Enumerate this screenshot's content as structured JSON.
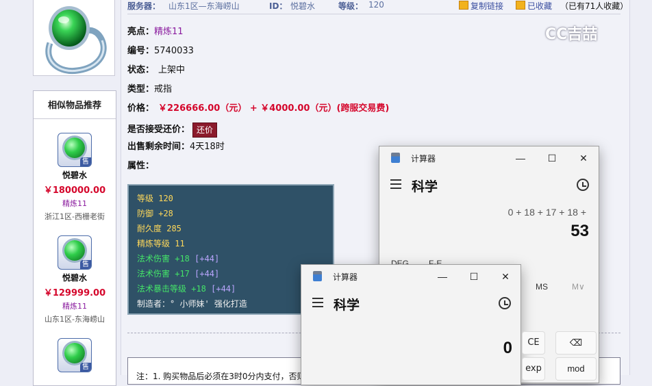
{
  "header": {
    "server_label": "服务器：",
    "server_value": "山东1区—东海崂山",
    "id_label": "ID：",
    "id_value": "悦碧水",
    "level_label": "等级：",
    "level_value": "120",
    "copy_link": "复制链接",
    "favorited": "已收藏",
    "fav_count_text": "（已有71人收藏）"
  },
  "watermark": "CC吉喆",
  "sidebar": {
    "similar_title": "相似物品推荐",
    "items": [
      {
        "name": "悦碧水",
        "price": "￥180000.00",
        "refine": "精炼11",
        "server": "浙江1区-西栅老街",
        "badge": "售"
      },
      {
        "name": "悦碧水",
        "price": "￥129999.00",
        "refine": "精炼11",
        "server": "山东1区-东海崂山",
        "badge": "售"
      },
      {
        "name": "",
        "price": "",
        "refine": "",
        "server": "",
        "badge": "售"
      }
    ]
  },
  "details": {
    "highlight_label": "亮点：",
    "highlight_value": "精炼11",
    "number_label": "编号：",
    "number_value": "5740033",
    "status_label": "状态：",
    "status_value": "上架中",
    "type_label": "类型：",
    "type_value": "戒指",
    "price_label": "价格：",
    "price_value": "￥226666.00（元） + ￥4000.00（元）(跨服交易费)",
    "counter_label": "是否接受还价：",
    "counter_button": "还价",
    "remain_label": "出售剩余时间：",
    "remain_value": "4天18时",
    "attr_label": "属性："
  },
  "attributes": [
    {
      "text": "等级 120",
      "style": "yellow",
      "bonus": ""
    },
    {
      "text": "防御 +28",
      "style": "yellow",
      "bonus": ""
    },
    {
      "text": "耐久度 285",
      "style": "yellow",
      "bonus": ""
    },
    {
      "text": "精炼等级 11",
      "style": "yellow",
      "bonus": ""
    },
    {
      "text": "法术伤害 +18 ",
      "style": "green",
      "bonus": "[+44]"
    },
    {
      "text": "法术伤害 +17 ",
      "style": "green",
      "bonus": "[+44]"
    },
    {
      "text": "法术暴击等级 +18 ",
      "style": "green",
      "bonus": "[+44]"
    },
    {
      "text": "制造者：° 小师妹' 强化打造",
      "style": "white",
      "bonus": ""
    }
  ],
  "note_text": "注：1. 购买物品后必须在3时0分内支付，否则",
  "calc_back": {
    "title": "计算器",
    "mode": "科学",
    "expression": "0 + 18 + 17 + 18 +",
    "result": "53",
    "deg": "DEG",
    "fe": "F-E",
    "ms": "MS",
    "mdrop": "M∨",
    "keys": {
      "backspace": "⌫",
      "mod": "mod"
    }
  },
  "calc_front": {
    "title": "计算器",
    "mode": "科学",
    "result": "0",
    "keys": {
      "ce": "CE",
      "exp": "exp"
    }
  },
  "window_controls": {
    "minimize": "—",
    "maximize": "☐",
    "close": "✕"
  }
}
